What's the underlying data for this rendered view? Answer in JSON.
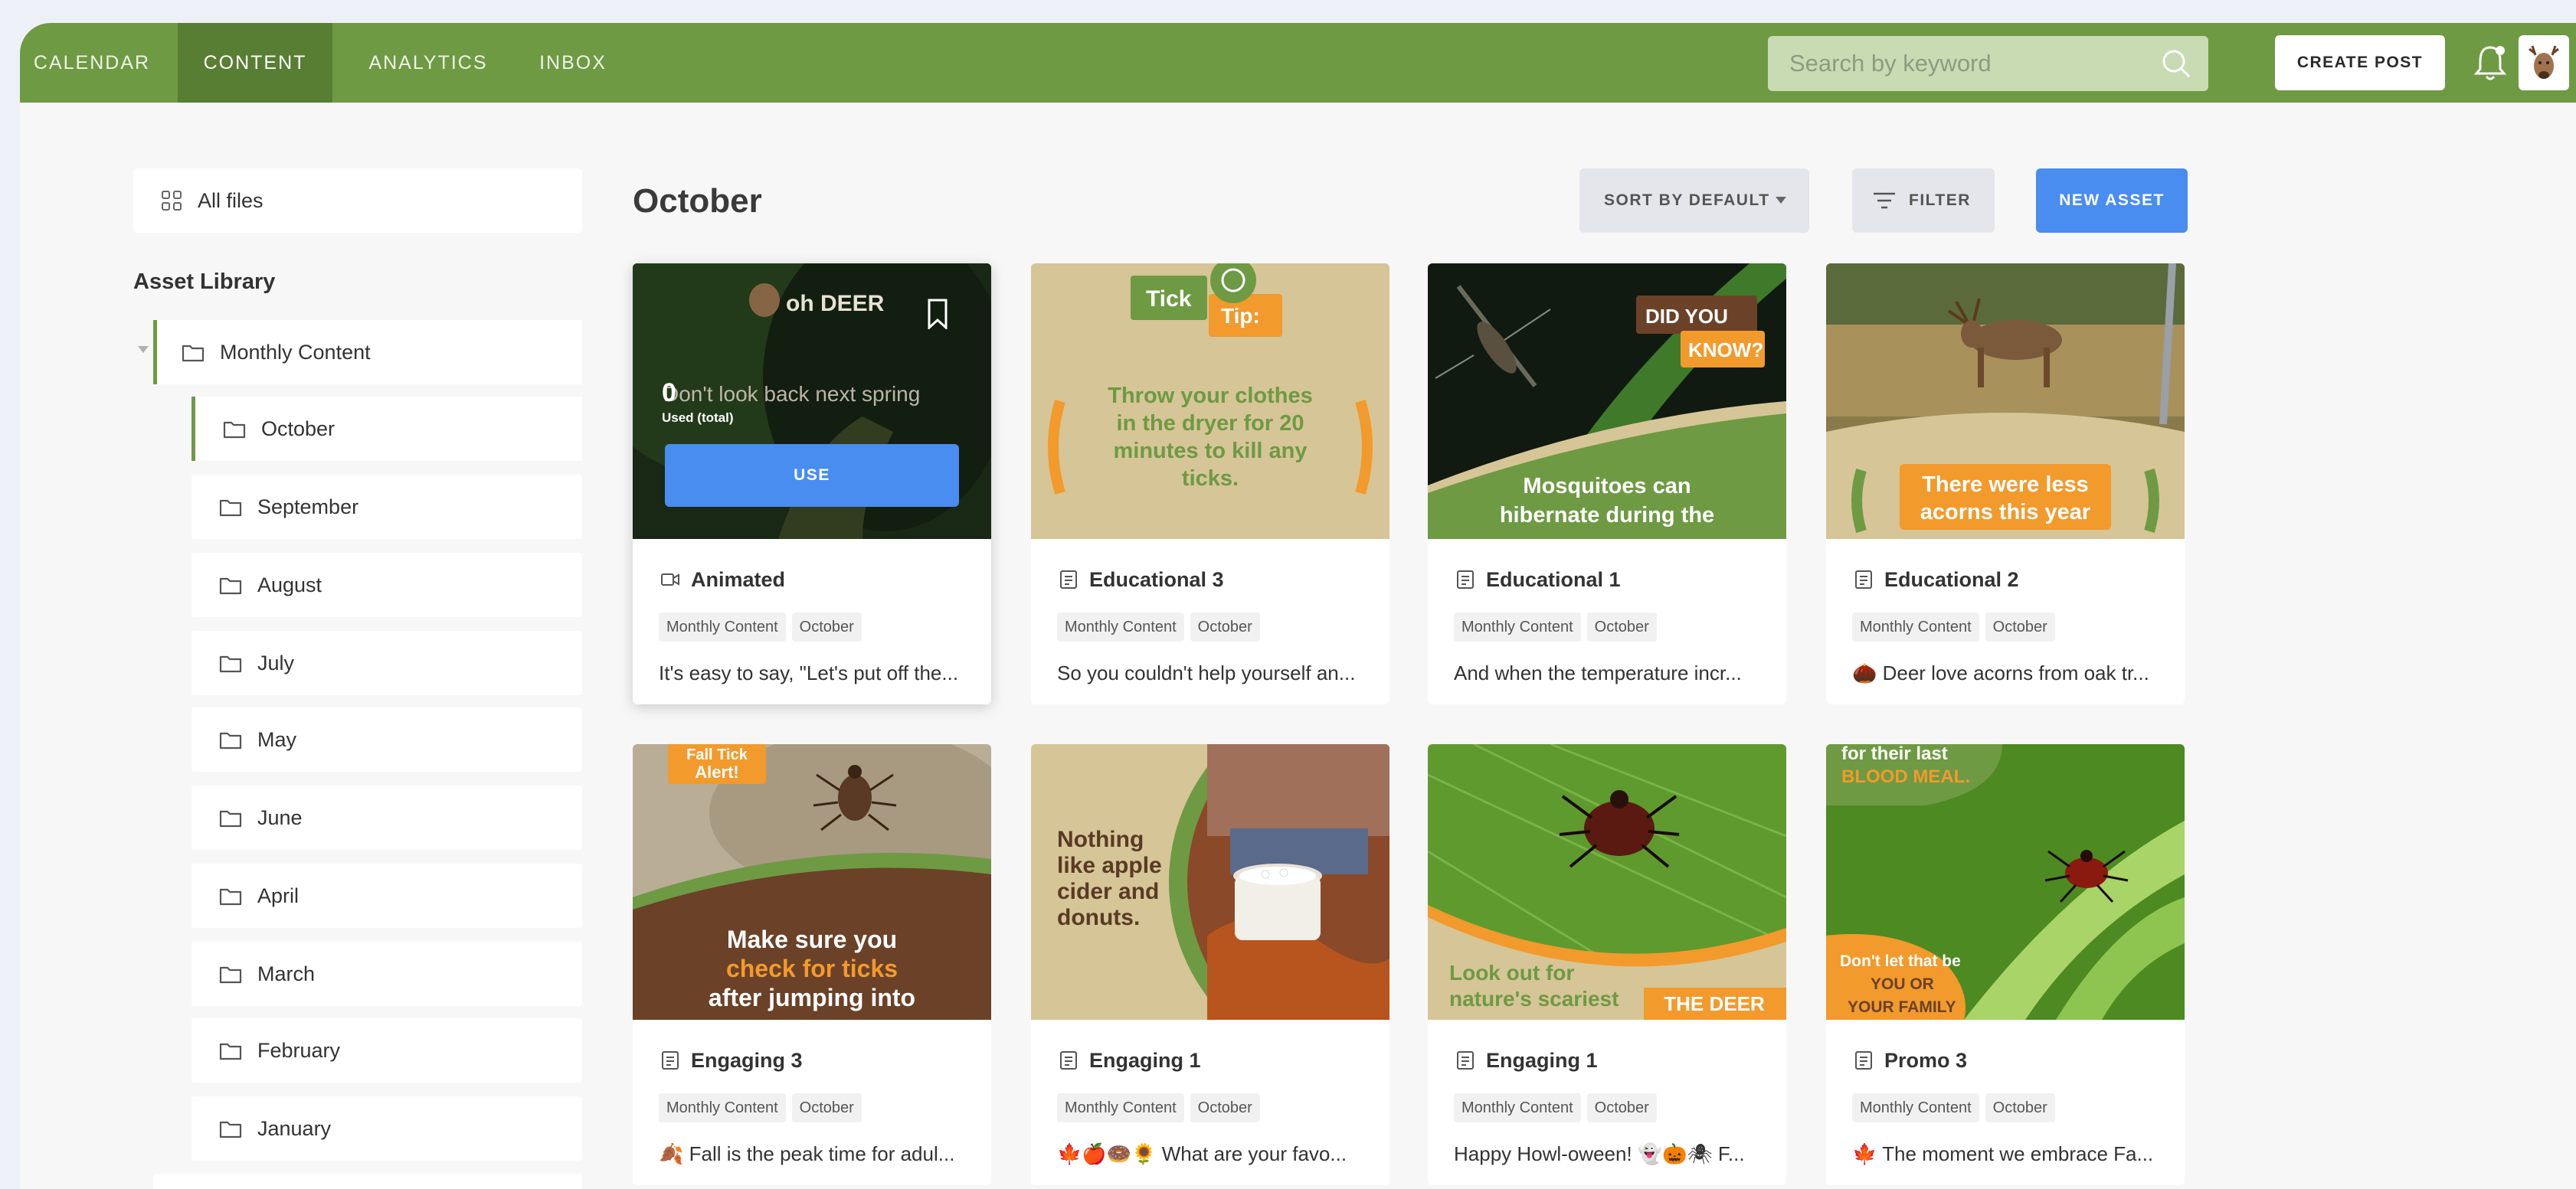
{
  "nav": {
    "tabs": [
      {
        "label": "CALENDAR",
        "active": false
      },
      {
        "label": "CONTENT",
        "active": true
      },
      {
        "label": "ANALYTICS",
        "active": false
      },
      {
        "label": "INBOX",
        "active": false
      }
    ],
    "search_placeholder": "Search by keyword",
    "create_post_label": "CREATE POST",
    "icons": [
      "search-icon",
      "bell-icon",
      "deer-avatar-icon"
    ]
  },
  "sidebar": {
    "all_files_label": "All files",
    "heading": "Asset Library",
    "parent_folder": "Monthly Content",
    "folders": [
      "October",
      "September",
      "August",
      "July",
      "May",
      "June",
      "April",
      "March",
      "February",
      "January"
    ],
    "active_folder": "October"
  },
  "main": {
    "title": "October",
    "sort_label": "SORT BY DEFAULT",
    "filter_label": "FILTER",
    "new_asset_label": "NEW ASSET",
    "use_label": "USE",
    "used_count": "0",
    "used_label": "Used (total)"
  },
  "cards": [
    {
      "title": "Animated",
      "type": "video",
      "tags": [
        "Monthly Content",
        "October"
      ],
      "desc": "It's easy to say, \"Let's put off the...",
      "art": {
        "logo_text": "oh DEER",
        "caption": "Don't look back next spring"
      }
    },
    {
      "title": "Educational 3",
      "type": "document",
      "tags": [
        "Monthly Content",
        "October"
      ],
      "desc": "So you couldn't help yourself an...",
      "art": {
        "badge1": "Tick",
        "badge2": "Tip:",
        "lines": [
          "Throw your clothes",
          "in the dryer for 20",
          "minutes to kill any",
          "ticks."
        ]
      }
    },
    {
      "title": "Educational 1",
      "type": "document",
      "tags": [
        "Monthly Content",
        "October"
      ],
      "desc": "And when the temperature incr...",
      "art": {
        "badge1": "DID YOU",
        "badge2": "KNOW?",
        "lines": [
          "Mosquitoes can",
          "hibernate during the"
        ]
      }
    },
    {
      "title": "Educational 2",
      "type": "document",
      "tags": [
        "Monthly Content",
        "October"
      ],
      "desc": "🌰 Deer love acorns from oak tr...",
      "art": {
        "lines": [
          "There were less",
          "acorns this year"
        ]
      }
    },
    {
      "title": "Engaging 3",
      "type": "document",
      "tags": [
        "Monthly Content",
        "October"
      ],
      "desc": "🍂 Fall is the peak time for adul...",
      "art": {
        "badge1": "Fall Tick",
        "badge2": "Alert!",
        "lines": [
          "Make sure you",
          "check for ticks",
          "after jumping into"
        ]
      }
    },
    {
      "title": "Engaging 1",
      "type": "document",
      "tags": [
        "Monthly Content",
        "October"
      ],
      "desc": "🍁🍎🍩🌻 What are your favo...",
      "art": {
        "lines": [
          "Nothing",
          "like apple",
          "cider and",
          "donuts."
        ]
      }
    },
    {
      "title": "Engaging 1",
      "type": "document",
      "tags": [
        "Monthly Content",
        "October"
      ],
      "desc": "Happy Howl-oween! 👻🎃🕷 F...",
      "art": {
        "badge1": "THE DEER",
        "lines": [
          "Look out for",
          "nature's scariest"
        ]
      }
    },
    {
      "title": "Promo 3",
      "type": "document",
      "tags": [
        "Monthly Content",
        "October"
      ],
      "desc": "🍁 The moment we embrace Fa...",
      "art": {
        "lines": [
          "for their last",
          "BLOOD MEAL."
        ],
        "lines2": [
          "Don't let that be",
          "YOU OR",
          "YOUR FAMILY"
        ]
      }
    }
  ],
  "colors": {
    "brand_green": "#6e9a43",
    "nav_active": "#577e33",
    "primary_blue": "#4a8df0",
    "orange": "#f39a2d",
    "brown": "#6b4228"
  }
}
